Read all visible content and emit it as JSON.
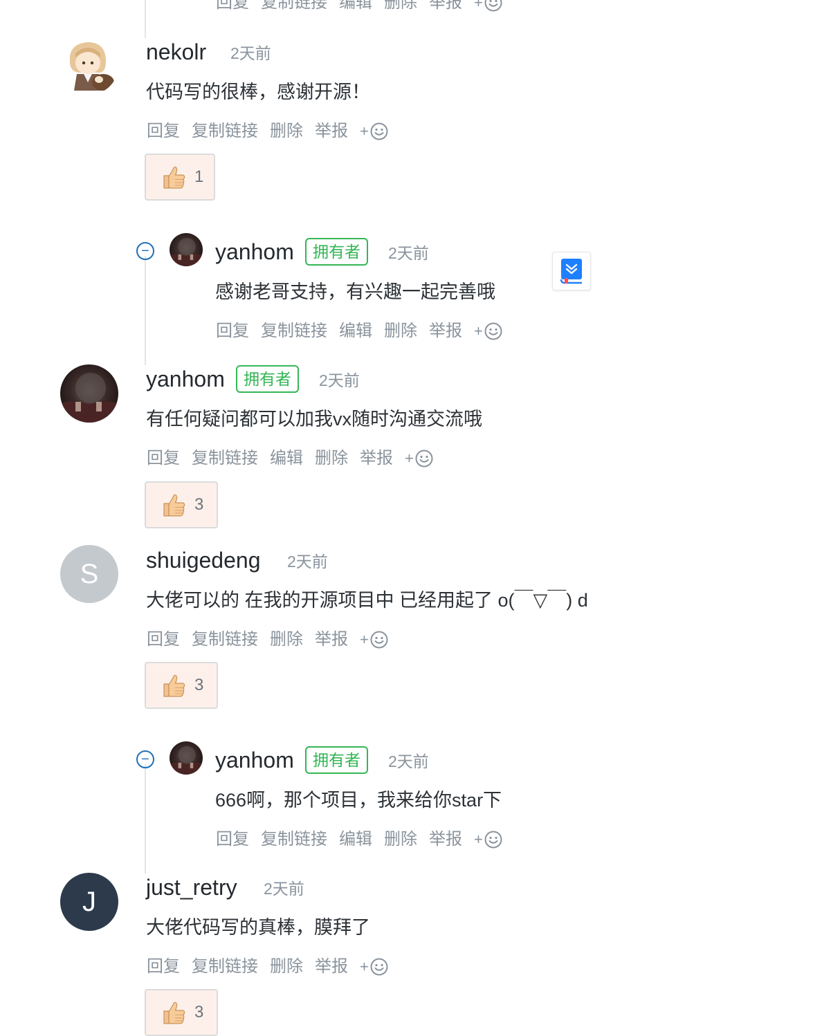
{
  "actions": {
    "reply": "回复",
    "copy_link": "复制链接",
    "edit": "编辑",
    "delete": "删除",
    "report": "举报",
    "plus": "+"
  },
  "owner_badge": "拥有者",
  "comments": [
    {
      "name": "nekolr",
      "time": "2天前",
      "text": "代码写的很棒，感谢开源！",
      "likes": "1"
    },
    {
      "name": "yanhom",
      "time": "2天前",
      "text": "感谢老哥支持，有兴趣一起完善哦"
    },
    {
      "name": "yanhom",
      "time": "2天前",
      "text": "有任何疑问都可以加我vx随时沟通交流哦",
      "likes": "3"
    },
    {
      "name": "shuigedeng",
      "avatar_letter": "S",
      "time": "2天前",
      "text": "大佬可以的 在我的开源项目中 已经用起了 o(￣▽￣) d",
      "likes": "3"
    },
    {
      "name": "yanhom",
      "time": "2天前",
      "text": "666啊，那个项目，我来给你star下"
    },
    {
      "name": "just_retry",
      "avatar_letter": "J",
      "time": "2天前",
      "text": "大佬代码写的真棒，膜拜了",
      "likes": "3"
    }
  ],
  "colors": {
    "owner_green": "#34b655",
    "link_blue": "#1f6fb8",
    "like_bg": "#fdf0ea",
    "avatar_s": "#c4c9ce",
    "avatar_j": "#2d3a4c"
  }
}
